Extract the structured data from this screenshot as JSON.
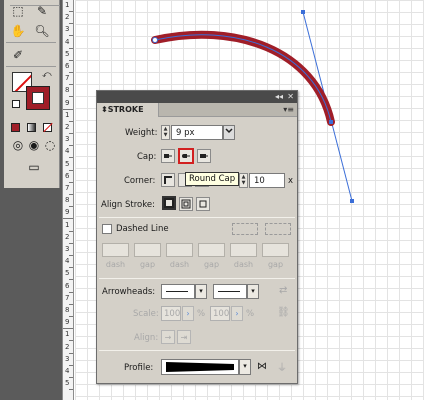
{
  "ruler": {
    "numbers": [
      "1",
      "2",
      "3",
      "4",
      "5",
      "6",
      "7",
      "8",
      "9",
      "1",
      "2",
      "3",
      "4",
      "5",
      "6",
      "7",
      "8",
      "9",
      "1",
      "2",
      "3",
      "4",
      "5",
      "6",
      "7",
      "8",
      "9",
      "1",
      "2",
      "3",
      "4",
      "5"
    ]
  },
  "stroke_panel": {
    "title": "STROKE",
    "collapse_glyph": "◂◂",
    "close_glyph": "✕",
    "menu_glyph": "▾≡",
    "weight_label": "Weight:",
    "weight_value": "9 px",
    "cap_label": "Cap:",
    "corner_label": "Corner:",
    "limit_suffix": "x",
    "limit_label": "t:",
    "limit_value": "10",
    "align_label": "Align Stroke:",
    "dashed_label": "Dashed Line",
    "dash_labels": [
      "dash",
      "gap",
      "dash",
      "gap",
      "dash",
      "gap"
    ],
    "arrowheads_label": "Arrowheads:",
    "scale_label": "Scale:",
    "scale_start": "100",
    "scale_end": "100",
    "percent": "%",
    "align_arrow_label": "Align:",
    "profile_label": "Profile:",
    "tooltip": "Round Cap"
  },
  "colors": {
    "stroke_path": "#a01e28",
    "selection_blue": "#3b6ed8",
    "highlight_red": "#d22020"
  },
  "icons": {
    "cap_butt": "butt-cap-icon",
    "cap_round": "round-cap-icon",
    "cap_projecting": "projecting-cap-icon"
  }
}
